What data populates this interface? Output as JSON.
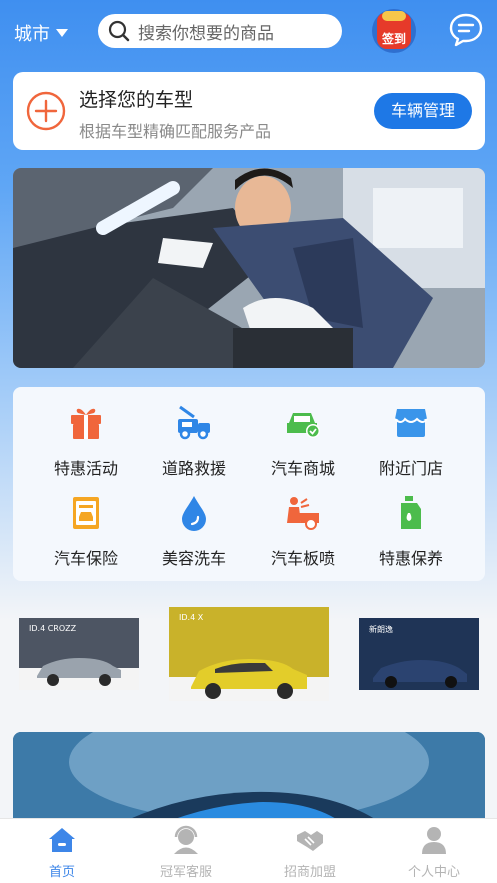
{
  "header": {
    "city_label": "城市",
    "search_placeholder": "搜索你想要的商品",
    "signin_label": "签到"
  },
  "car_select": {
    "title": "选择您的车型",
    "subtitle": "根据车型精确匹配服务产品",
    "button_label": "车辆管理"
  },
  "services": [
    {
      "label": "特惠活动",
      "icon": "gift-icon",
      "color": "#f0663c"
    },
    {
      "label": "道路救援",
      "icon": "tow-truck-icon",
      "color": "#2f86e6"
    },
    {
      "label": "汽车商城",
      "icon": "car-mall-icon",
      "color": "#4cbc4c"
    },
    {
      "label": "附近门店",
      "icon": "store-icon",
      "color": "#3a95ea"
    },
    {
      "label": "汽车保险",
      "icon": "insurance-doc-icon",
      "color": "#f5a623"
    },
    {
      "label": "美容洗车",
      "icon": "water-drop-icon",
      "color": "#2f86e6"
    },
    {
      "label": "汽车板喷",
      "icon": "spray-paint-icon",
      "color": "#f0663c"
    },
    {
      "label": "特惠保养",
      "icon": "oil-can-icon",
      "color": "#4cbc4c"
    }
  ],
  "car_thumbs": [
    {
      "tag": "ID.4 CROZZ",
      "bg": "#4d5563",
      "car": "#9aa3ad"
    },
    {
      "tag": "ID.4 X",
      "bg": "#c9b22a",
      "car": "#e3cd2a"
    },
    {
      "tag": "新朗逸",
      "bg": "#1f3456",
      "car": "#24385e"
    }
  ],
  "tabs": [
    {
      "label": "首页",
      "icon": "home-icon",
      "active": true
    },
    {
      "label": "冠军客服",
      "icon": "customer-service-icon",
      "active": false
    },
    {
      "label": "招商加盟",
      "icon": "handshake-icon",
      "active": false
    },
    {
      "label": "个人中心",
      "icon": "user-icon",
      "active": false
    }
  ],
  "colors": {
    "accent": "#1e78e6",
    "tab_active": "#3d86e8",
    "tab_inactive": "#b4b4b4",
    "plus_orange": "#f0663c"
  }
}
